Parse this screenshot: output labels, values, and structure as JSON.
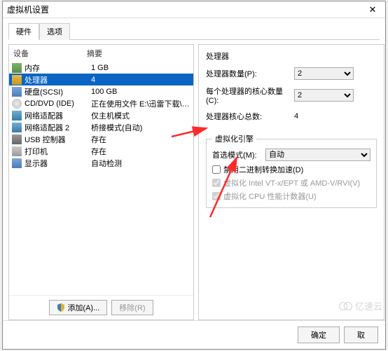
{
  "title": "虚拟机设置",
  "tabs": {
    "hardware": "硬件",
    "options": "选项"
  },
  "headers": {
    "device": "设备",
    "summary": "摘要"
  },
  "devices": [
    {
      "icon": "ic-mem",
      "name": "内存",
      "summary": "1 GB"
    },
    {
      "icon": "ic-cpu",
      "name": "处理器",
      "summary": "4"
    },
    {
      "icon": "ic-disk",
      "name": "硬盘(SCSI)",
      "summary": "100 GB"
    },
    {
      "icon": "ic-cd",
      "name": "CD/DVD (IDE)",
      "summary": "正在使用文件 E:\\迅雷下载\\CentOS-..."
    },
    {
      "icon": "ic-net",
      "name": "网络适配器",
      "summary": "仅主机模式"
    },
    {
      "icon": "ic-net",
      "name": "网络适配器 2",
      "summary": "桥接模式(自动)"
    },
    {
      "icon": "ic-usb",
      "name": "USB 控制器",
      "summary": "存在"
    },
    {
      "icon": "ic-print",
      "name": "打印机",
      "summary": "存在"
    },
    {
      "icon": "ic-display",
      "name": "显示器",
      "summary": "自动检测"
    }
  ],
  "selectedIndex": 1,
  "buttons": {
    "add": "添加(A)...",
    "remove": "移除(R)",
    "ok": "确定",
    "cancel": "取"
  },
  "processor": {
    "section": "处理器",
    "countLabel": "处理器数量(P):",
    "count": "2",
    "coresLabel": "每个处理器的核心数量(C):",
    "cores": "2",
    "totalLabel": "处理器核心总数:",
    "total": "4"
  },
  "virt": {
    "section": "虚拟化引擎",
    "prefLabel": "首选模式(M):",
    "pref": "自动",
    "disableAccel": "禁用二进制转换加速(D)",
    "vt": "虚拟化 Intel VT-x/EPT 或 AMD-V/RVI(V)",
    "perf": "虚拟化 CPU 性能计数器(U)"
  },
  "watermark": "亿速云"
}
